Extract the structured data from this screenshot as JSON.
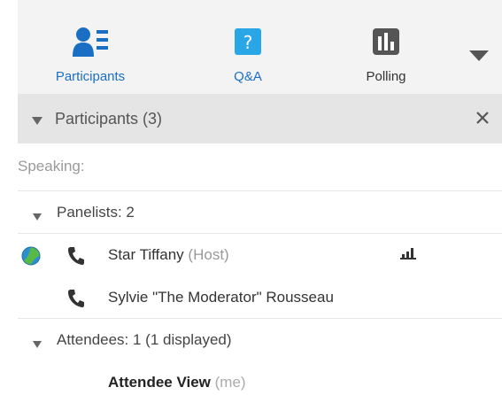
{
  "toolbar": {
    "tools": [
      {
        "label": "Participants",
        "color": "#1a6fc4",
        "active": true
      },
      {
        "label": "Q&A",
        "color": "#1a6fc4",
        "active": false
      },
      {
        "label": "Polling",
        "color": "#333333",
        "active": false
      }
    ],
    "more_icon": "chevron-down-icon"
  },
  "participants": {
    "header": "Participants (3)",
    "close_icon": "close-icon",
    "speaking_label": "Speaking:",
    "panelists": {
      "label": "Panelists: 2",
      "members": [
        {
          "name": "Star Tiffany",
          "role": "(Host)",
          "status_icon": "status-globe-icon",
          "phone_icon": "phone-icon",
          "signal_icon": "audio-level-icon"
        },
        {
          "name": "Sylvie \"The Moderator\" Rousseau",
          "role": "",
          "phone_icon": "phone-icon"
        }
      ]
    },
    "attendees": {
      "label": "Attendees: 1 (1 displayed)",
      "members": [
        {
          "name": "Attendee View",
          "suffix": "(me)"
        }
      ]
    }
  },
  "colors": {
    "accent": "#1a6fc4",
    "toolbar_bg": "#f3f3f3",
    "header_bg": "#e5e5e5",
    "status_green": "#58b947"
  }
}
